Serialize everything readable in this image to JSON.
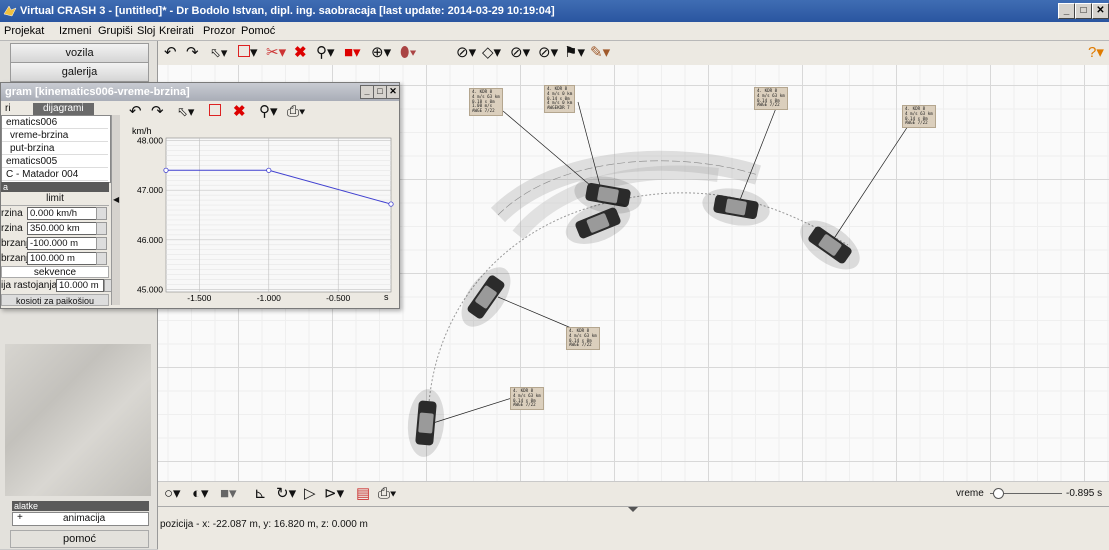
{
  "window": {
    "title": "Virtual CRASH 3 - [untitled]* - Dr Bodolo Istvan, dipl. ing. saobracaja [last update: 2014-03-29 10:19:04]"
  },
  "menu": [
    "Projekat",
    "Izmeni",
    "Grupiši",
    "Sloj",
    "Kreirati",
    "Prozor",
    "Pomoć"
  ],
  "left": {
    "btn_vozila": "vozila",
    "btn_galerija": "galerija",
    "alatke_title": "alatke",
    "alatke_item": "animacija",
    "alatke_plus": "+",
    "help": "pomoć"
  },
  "diagram": {
    "title": "gram [kinematics006-vreme-brzina]",
    "tab1": "ri",
    "tab2": "dijagrami",
    "items": [
      "ematics006",
      "vreme-brzina",
      "put-brzina",
      "ematics005",
      "C - Matador 004"
    ],
    "panel_tab": "a",
    "limit": "limit",
    "fields": [
      {
        "label": "rzina",
        "value": "0.000 km/h"
      },
      {
        "label": "rzina",
        "value": "350.000 km"
      },
      {
        "label": "brzanje",
        "value": "-100.000 m"
      },
      {
        "label": "brzanje",
        "value": "100.000 m"
      }
    ],
    "sekvence": "sekvence",
    "rast_label": "ija rastojanja",
    "rast_value": "10.000 m",
    "bottom_btn": "kosioti za paikošiou"
  },
  "chart_data": {
    "type": "line",
    "ylabel": "km/h",
    "xlabel": "s",
    "yticks": [
      "48.000",
      "47.000",
      "46.000",
      "45.000"
    ],
    "xticks": [
      "-1.500",
      "-1.000",
      "-0.500"
    ],
    "ylim": [
      44.95,
      48.05
    ],
    "xlim": [
      -1.74,
      -0.12
    ],
    "series": [
      {
        "x": [
          -1.74,
          -1.0,
          -0.12
        ],
        "y": [
          47.4,
          47.4,
          46.72
        ]
      }
    ]
  },
  "status": {
    "position": "pozicija - x: -22.087 m, y: 16.820 m, z: 0.000 m"
  },
  "bottom": {
    "vreme_label": "vreme",
    "vreme_value": "-0.895 s",
    "vreme_fraction": 0.1
  },
  "label_boxes": [
    "4. KDR 8\n4 m/s 63 km\n0.18 s 0m\n1.00 m/s\nAWGE 7/22",
    "4. KDR 8\n4 m/s 0 km\n0.14 s 0m\n4 m/s 0 km\nAWGEKDR 7",
    "4. KDR 8\n4 m/s 63 km\n0.14 s 0m\nAWGE 7/22",
    "4. KDR 8\n4 m/s 63 km\n0.14 s 0m\nAWGE 7/22",
    "4. KDR 8\n4 m/s 63 km\n0.14 s 0m\nAWGE 7/22",
    "4. KDR 8\n4 m/s 63 km\n0.14 s 0m\nAWGE 7/22"
  ]
}
